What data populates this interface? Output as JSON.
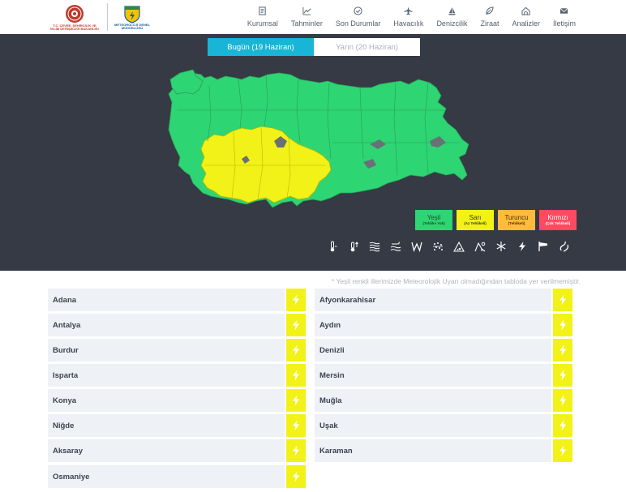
{
  "header": {
    "ministry_caption": "T.C. ÇEVRE, ŞEHİRCİLİK VE İKLİM DEĞİŞİKLİĞİ BAKANLIĞI",
    "mgm_caption": "METEOROLOJİ GENEL MÜDÜRLÜĞÜ",
    "nav": [
      {
        "label": "Kurumsal",
        "icon": "document-icon"
      },
      {
        "label": "Tahminler",
        "icon": "chart-icon"
      },
      {
        "label": "Son Durumlar",
        "icon": "check-circle-icon"
      },
      {
        "label": "Havacılık",
        "icon": "plane-icon"
      },
      {
        "label": "Denizcilik",
        "icon": "sail-icon"
      },
      {
        "label": "Ziraat",
        "icon": "leaf-icon"
      },
      {
        "label": "Analizler",
        "icon": "home-analysis-icon"
      },
      {
        "label": "İletişim",
        "icon": "envelope-icon"
      }
    ]
  },
  "tabs": [
    {
      "label": "Bugün (19 Haziran)",
      "active": true
    },
    {
      "label": "Yarın (20 Haziran)",
      "active": false
    }
  ],
  "legend": [
    {
      "label": "Yeşil",
      "sub": "(Tehlike Yok)",
      "color": "#2ed573",
      "text_color": "#1e4f2b"
    },
    {
      "label": "Sarı",
      "sub": "(Az Tehlikeli)",
      "color": "#f2f218",
      "text_color": "#3a3a00"
    },
    {
      "label": "Turuncu",
      "sub": "(Tehlikeli)",
      "color": "#ffbb3a",
      "text_color": "#4d3000"
    },
    {
      "label": "Kırmızı",
      "sub": "(Çok Tehlikeli)",
      "color": "#ff4a62",
      "text_color": "#ffffff"
    }
  ],
  "hazards": [
    "thermometer-low-icon",
    "thermometer-high-icon",
    "fog-icon",
    "wind-wave-icon",
    "wind-icon",
    "dust-icon",
    "avalanche-icon",
    "snow-melt-icon",
    "snowflake-icon",
    "lightning-icon",
    "gale-flag-icon",
    "storm-icon"
  ],
  "note": "* Yeşil renkli illerimizde Meteorolojik Uyarı olmadığından tabloda yer verilmemiştir.",
  "provinces_left": [
    "Adana",
    "Antalya",
    "Burdur",
    "Isparta",
    "Konya",
    "Niğde",
    "Aksaray",
    "Osmaniye"
  ],
  "provinces_right": [
    "Afyonkarahisar",
    "Aydın",
    "Denizli",
    "Mersin",
    "Muğla",
    "Uşak",
    "Karaman"
  ],
  "colors": {
    "map_green": "#2ed573",
    "map_yellow": "#f2f218",
    "panel_bg": "#353a45",
    "tab_active": "#19b5d6",
    "bolt_bg": "#f2f218"
  }
}
